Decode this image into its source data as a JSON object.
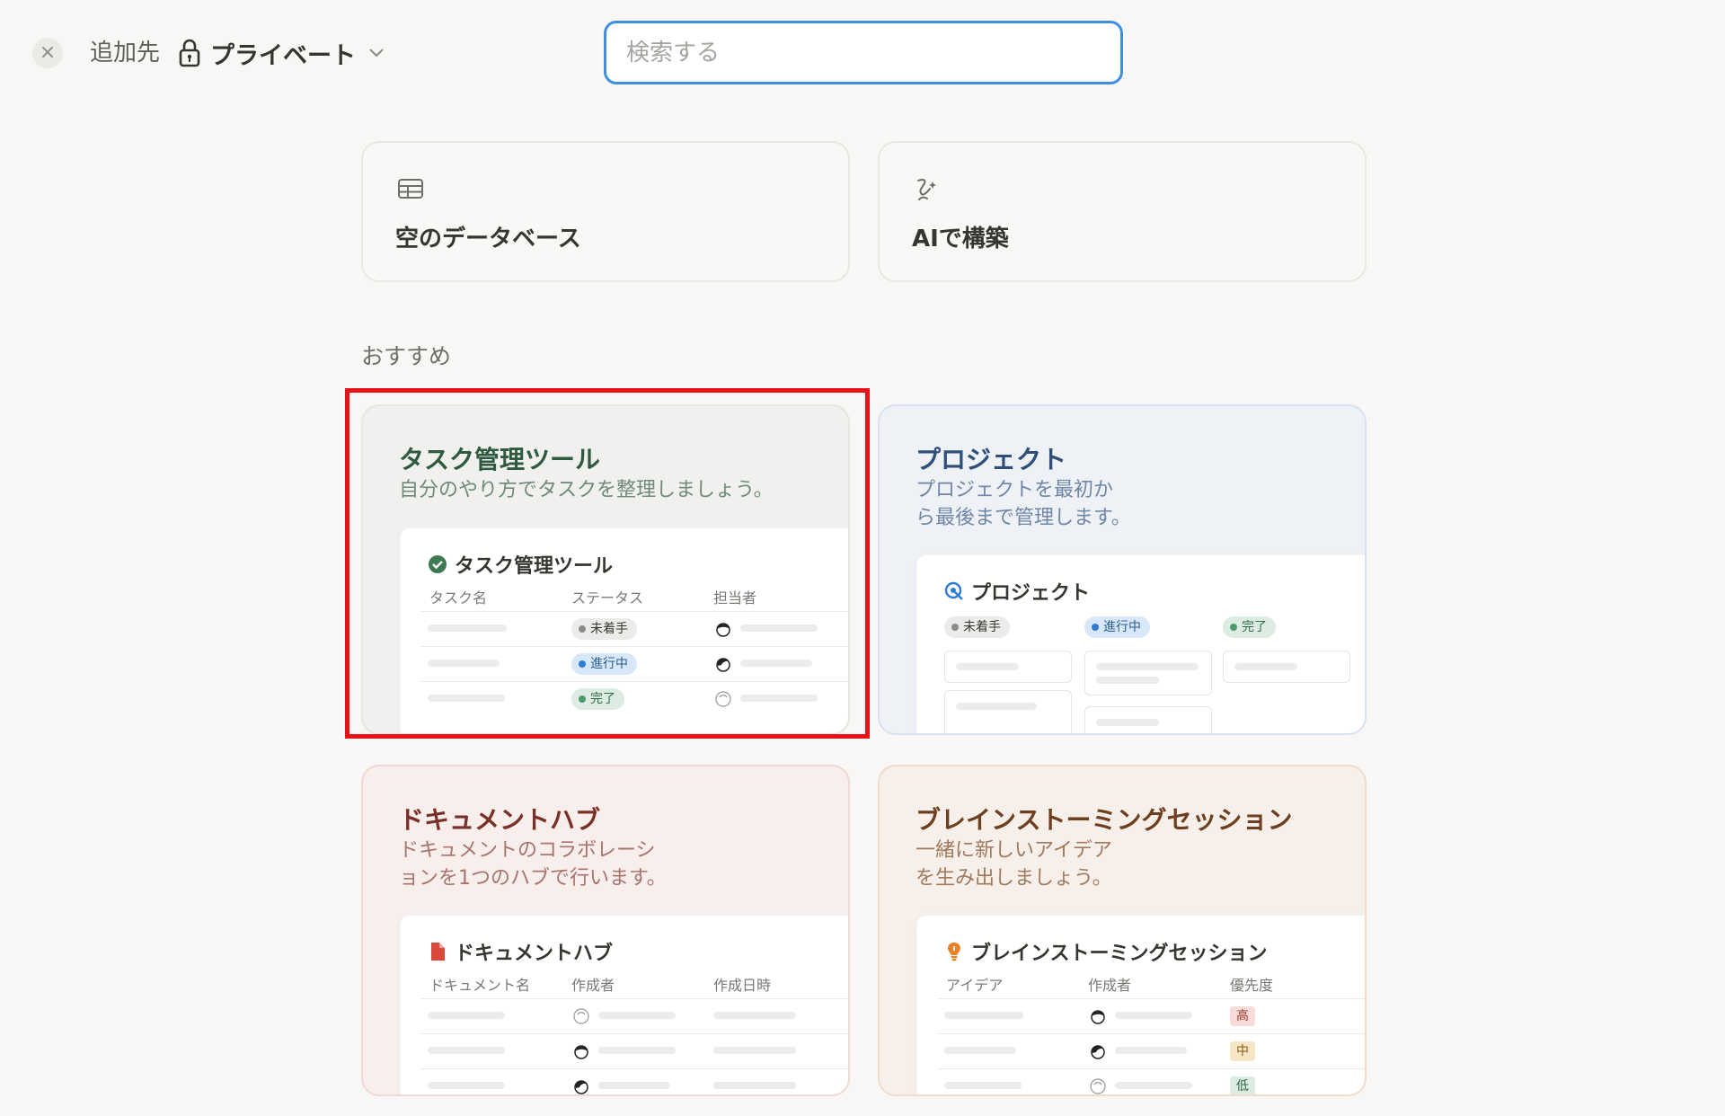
{
  "topbar": {
    "close_symbol": "×",
    "add_to_label": "追加先",
    "location": "プライベート",
    "search_placeholder": "検索する"
  },
  "options": {
    "blank_database": "空のデータベース",
    "ai_build": "AIで構築"
  },
  "section_title": "おすすめ",
  "templates": {
    "task": {
      "title": "タスク管理ツール",
      "description": "自分のやり方でタスクを整理しましょう。",
      "preview_title": "タスク管理ツール",
      "columns": [
        "タスク名",
        "ステータス",
        "担当者"
      ],
      "statuses": [
        "未着手",
        "進行中",
        "完了"
      ]
    },
    "project": {
      "title": "プロジェクト",
      "description_line1": "プロジェクトを最初か",
      "description_line2": "ら最後まで管理します。",
      "preview_title": "プロジェクト",
      "groups": [
        "未着手",
        "進行中",
        "完了"
      ]
    },
    "doc": {
      "title": "ドキュメントハブ",
      "description_line1": "ドキュメントのコラボレーシ",
      "description_line2": "ョンを1つのハブで行います。",
      "preview_title": "ドキュメントハブ",
      "columns": [
        "ドキュメント名",
        "作成者",
        "作成日時"
      ]
    },
    "brain": {
      "title": "ブレインストーミングセッション",
      "description_line1": "一緒に新しいアイデア",
      "description_line2": "を生み出しましょう。",
      "preview_title": "ブレインストーミングセッション",
      "columns": [
        "アイデア",
        "作成者",
        "優先度"
      ],
      "priorities": [
        "高",
        "中",
        "低"
      ]
    }
  },
  "colors": {
    "highlight": "#e8121a",
    "search_border": "#3d8fe0"
  }
}
